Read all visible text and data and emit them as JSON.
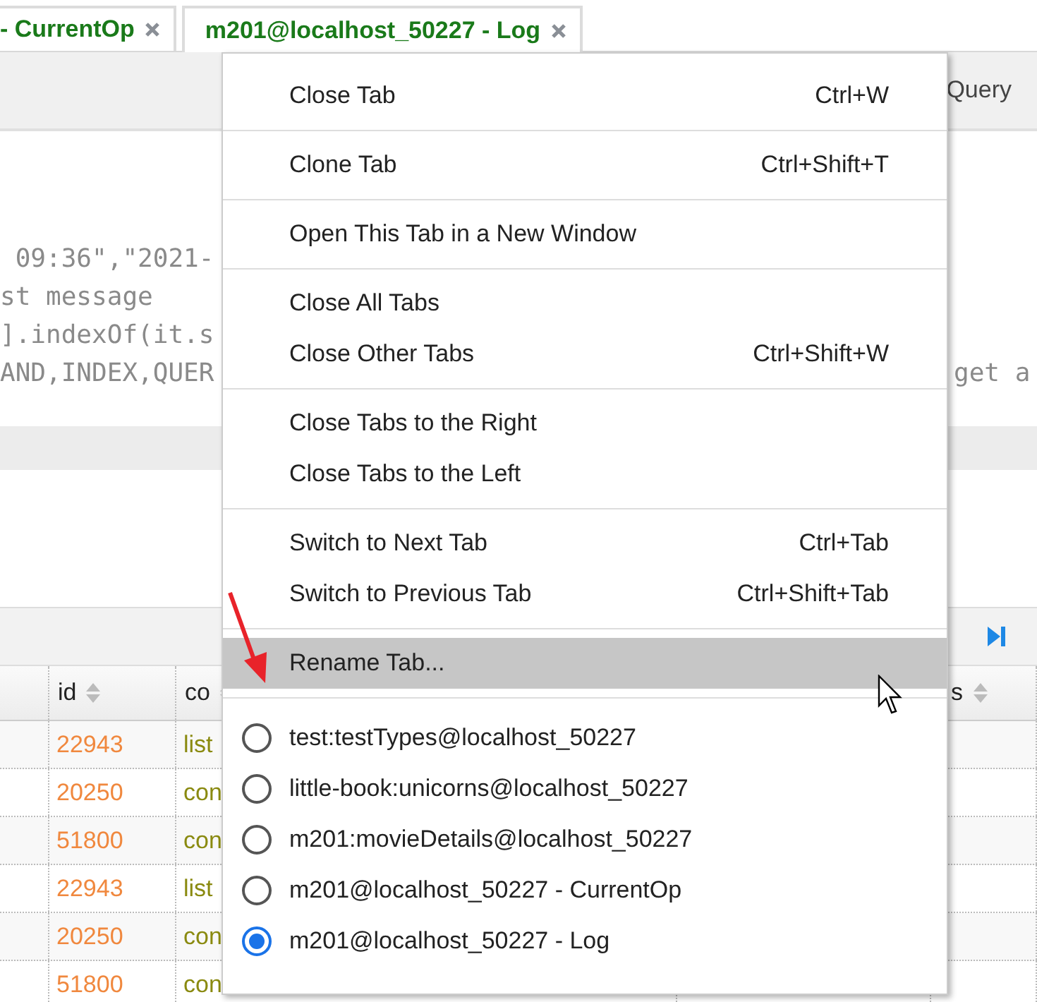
{
  "tabs": [
    {
      "label": "- CurrentOp",
      "selected": false
    },
    {
      "label": "m201@localhost_50227 - Log",
      "selected": true
    }
  ],
  "toolbar": {
    "button": "Query"
  },
  "editor": {
    "lines": [
      {
        "text": " 09:36\",\"2021-"
      },
      {
        "text": "st message"
      },
      {
        "text": "].indexOf(it.s"
      },
      {
        "text": "AND,INDEX,QUER",
        "tail": "get a"
      }
    ]
  },
  "table": {
    "columns": [
      {},
      {
        "label": "id"
      },
      {
        "label": "co"
      },
      {},
      {
        "label": "s"
      }
    ],
    "rows": [
      {
        "id": "22943",
        "column_3": "list"
      },
      {
        "id": "20250",
        "column_3": "con"
      },
      {
        "id": "51800",
        "column_3": "con"
      },
      {
        "id": "22943",
        "column_3": "list"
      },
      {
        "id": "20250",
        "column_3": "con"
      },
      {
        "id": "51800",
        "column_3": "con"
      }
    ]
  },
  "context_menu": {
    "sections": [
      [
        {
          "label": "Close Tab",
          "shortcut": "Ctrl+W",
          "highlighted": false
        }
      ],
      [
        {
          "label": "Clone Tab",
          "shortcut": "Ctrl+Shift+T",
          "highlighted": false
        }
      ],
      [
        {
          "label": "Open This Tab in a New Window",
          "highlighted": false
        }
      ],
      [
        {
          "label": "Close All Tabs",
          "highlighted": false
        },
        {
          "label": "Close Other Tabs",
          "shortcut": "Ctrl+Shift+W",
          "highlighted": false
        }
      ],
      [
        {
          "label": "Close Tabs to the Right",
          "highlighted": false
        },
        {
          "label": "Close Tabs to the Left",
          "highlighted": false
        }
      ],
      [
        {
          "label": "Switch to Next Tab",
          "shortcut": "Ctrl+Tab",
          "highlighted": false
        },
        {
          "label": "Switch to Previous Tab",
          "shortcut": "Ctrl+Shift+Tab",
          "highlighted": false
        }
      ],
      [
        {
          "label": "Rename Tab...",
          "highlighted": true
        }
      ]
    ],
    "tab_list": [
      {
        "label": "test:testTypes@localhost_50227",
        "selected": false
      },
      {
        "label": "little-book:unicorns@localhost_50227",
        "selected": false
      },
      {
        "label": "m201:movieDetails@localhost_50227",
        "selected": false
      },
      {
        "label": "m201@localhost_50227 - CurrentOp",
        "selected": false
      },
      {
        "label": "m201@localhost_50227 - Log",
        "selected": true
      }
    ]
  }
}
